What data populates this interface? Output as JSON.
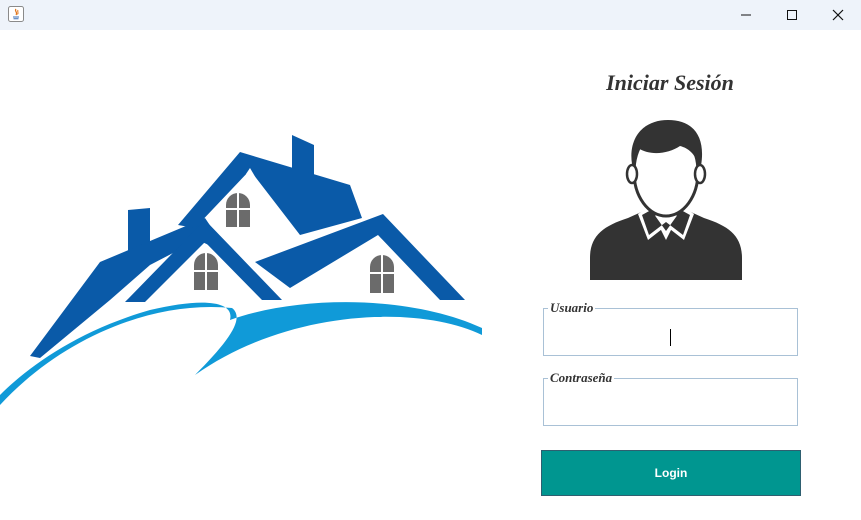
{
  "window": {
    "title": "",
    "controls": {
      "minimize_icon": "minimize-icon",
      "maximize_icon": "maximize-icon",
      "close_icon": "close-icon"
    }
  },
  "login": {
    "title": "Iniciar Sesión",
    "username_label": "Usuario",
    "username_value": "",
    "password_label": "Contraseña",
    "password_value": "",
    "login_button": "Login"
  },
  "colors": {
    "titlebar": "#eef3fa",
    "roof_blue": "#0a5aa8",
    "wave_blue": "#109ad8",
    "window_gray": "#6b6b6b",
    "avatar_dark": "#333333",
    "field_border": "#a9c1d6",
    "button_teal": "#009690"
  }
}
